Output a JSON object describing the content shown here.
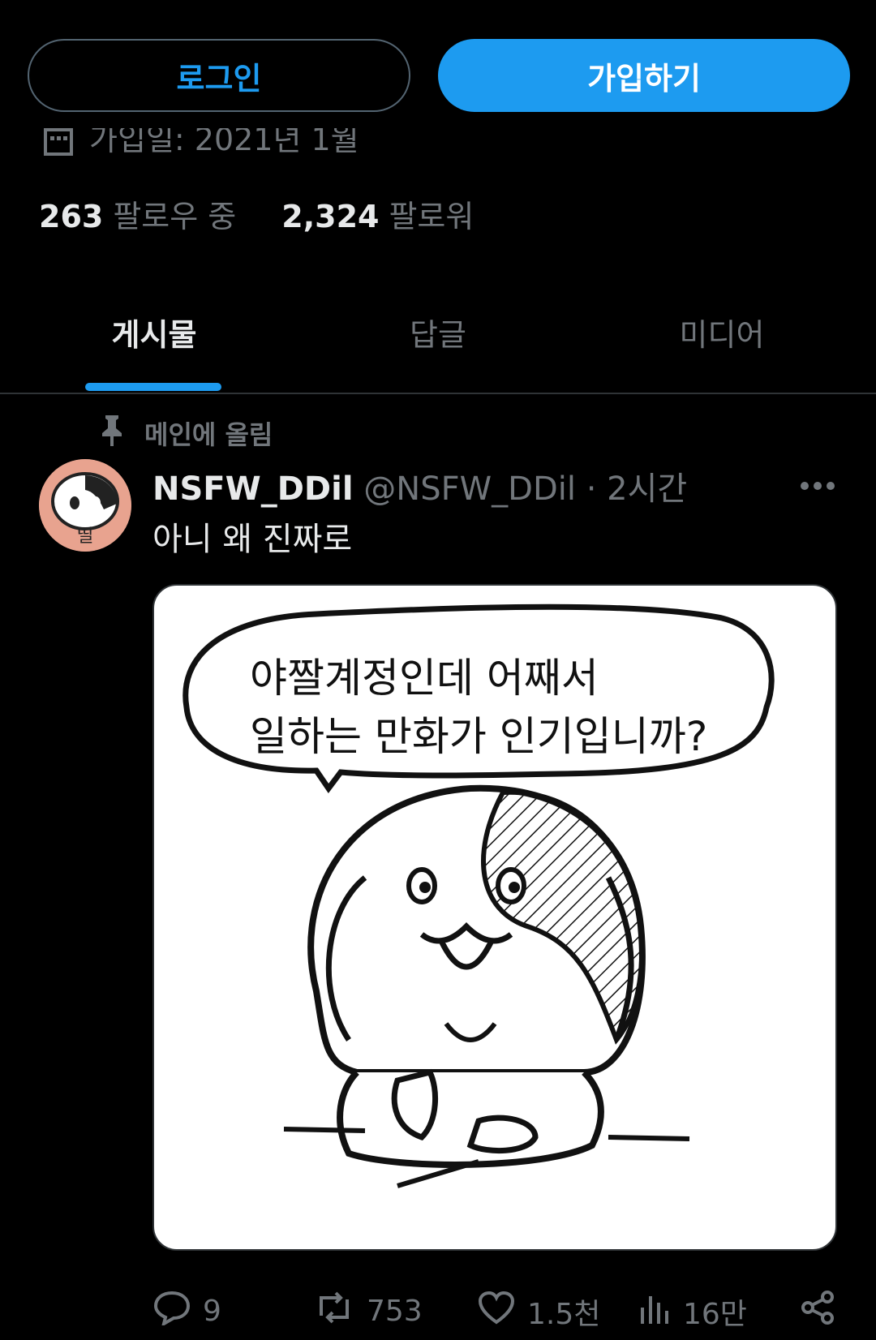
{
  "auth": {
    "login_label": "로그인",
    "signup_label": "가입하기"
  },
  "profile": {
    "joined": "가입일: 2021년 1월",
    "following_count": "263",
    "following_label": "팔로우 중",
    "followers_count": "2,324",
    "followers_label": "팔로워"
  },
  "tabs": [
    {
      "label": "게시물",
      "active": true
    },
    {
      "label": "답글",
      "active": false
    },
    {
      "label": "미디어",
      "active": false
    }
  ],
  "post": {
    "pinned_label": "메인에 올림",
    "display_name": "NSFW_DDil",
    "handle": "@NSFW_DDil",
    "time": "· 2시간",
    "text": "아니 왜 진짜로",
    "avatar_text": "띨",
    "media": {
      "bubble_line1": "야짤계정인데 어째서",
      "bubble_line2": "일하는 만화가 인기입니까?"
    },
    "actions": {
      "replies": "9",
      "reposts": "753",
      "likes": "1.5천",
      "views": "16만"
    }
  },
  "colors": {
    "accent": "#1d9bf0",
    "muted": "#71767b",
    "background": "#000000"
  }
}
